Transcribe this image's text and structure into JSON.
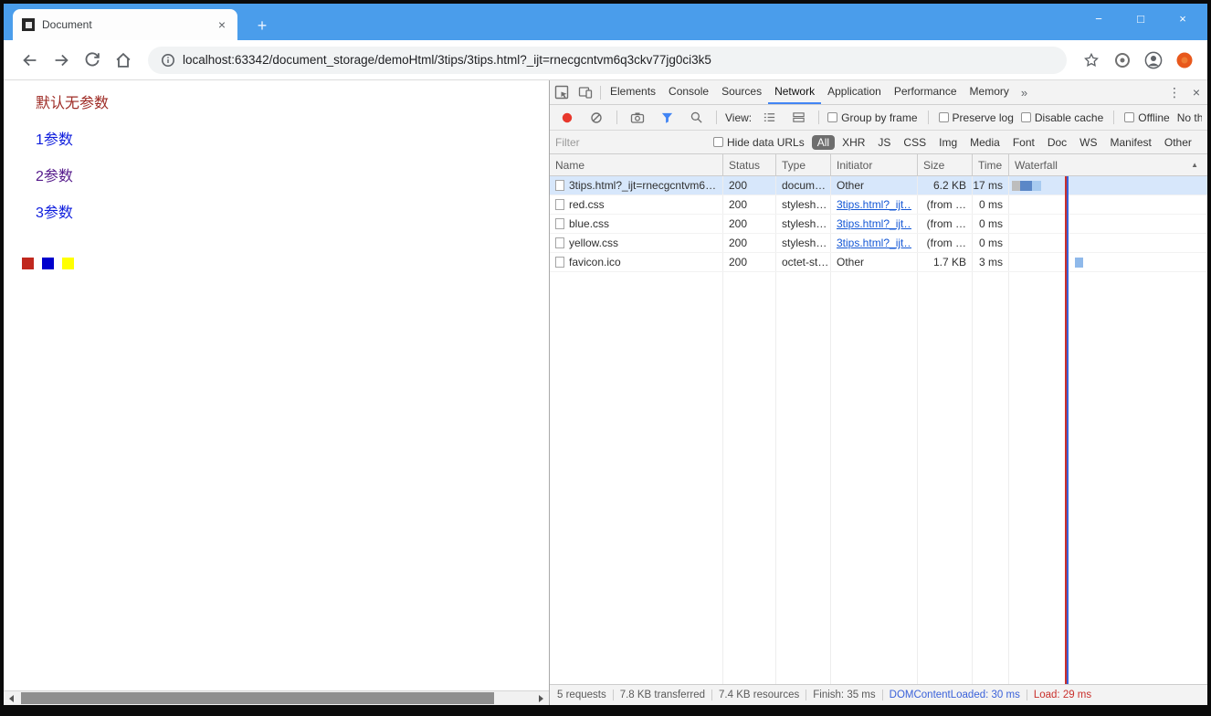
{
  "window": {
    "tab": {
      "title": "Document",
      "close_glyph": "×",
      "new_tab_glyph": "+"
    },
    "controls": {
      "minimize": "−",
      "maximize": "□",
      "close": "×"
    },
    "url": "localhost:63342/document_storage/demoHtml/3tips/3tips.html?_ijt=rnecgcntvm6q3ckv77jg0ci3k5"
  },
  "page": {
    "links": [
      {
        "label": "默认无参数",
        "color": "#9e2b25"
      },
      {
        "label": "1参数",
        "color": "#0f1edd"
      },
      {
        "label": "2参数",
        "color": "#551a8b"
      },
      {
        "label": "3参数",
        "color": "#0f1edd"
      }
    ],
    "squares": [
      {
        "name": "red-square",
        "color": "#c0281e"
      },
      {
        "name": "blue-square",
        "color": "#0000cd"
      },
      {
        "name": "yellow-square",
        "color": "#ffff00"
      }
    ]
  },
  "devtools": {
    "tabs": [
      "Elements",
      "Console",
      "Sources",
      "Network",
      "Application",
      "Performance",
      "Memory"
    ],
    "active_tab": "Network",
    "more_tabs_glyph": "»",
    "icons": {
      "more": "⋮",
      "close": "×"
    },
    "toolbar": {
      "view_label": "View:",
      "groups": [
        [
          "Group by frame"
        ],
        [
          "Preserve log",
          "Disable cache"
        ],
        [
          "Offline"
        ]
      ],
      "throttle": "No throttl"
    },
    "filter": {
      "placeholder": "Filter",
      "hide_data_urls": "Hide data URLs",
      "types": [
        "All",
        "XHR",
        "JS",
        "CSS",
        "Img",
        "Media",
        "Font",
        "Doc",
        "WS",
        "Manifest",
        "Other"
      ],
      "active_type": "All"
    },
    "table": {
      "columns": [
        "Name",
        "Status",
        "Type",
        "Initiator",
        "Size",
        "Time",
        "Waterfall"
      ],
      "sort_indicator": "▲",
      "rows": [
        {
          "name": "3tips.html?_ijt=rnecgcntvm6…",
          "status": "200",
          "type": "docum…",
          "initiator": "Other",
          "initiator_is_link": false,
          "size": "6.2 KB",
          "time": "17 ms",
          "selected": true,
          "waterfall": {
            "segments": [
              {
                "x": 3,
                "w": 9,
                "color": "#bdbdbd"
              },
              {
                "x": 12,
                "w": 13,
                "color": "#5b87c7"
              },
              {
                "x": 25,
                "w": 10,
                "color": "#a8cbf0"
              }
            ]
          }
        },
        {
          "name": "red.css",
          "status": "200",
          "type": "stylesh…",
          "initiator": "3tips.html?_ijt…",
          "initiator_is_link": true,
          "size": "(from …",
          "time": "0 ms",
          "selected": false,
          "waterfall": {
            "segments": [
              {
                "x": 61,
                "w": 3,
                "color": "#7fb0e8"
              }
            ]
          }
        },
        {
          "name": "blue.css",
          "status": "200",
          "type": "stylesh…",
          "initiator": "3tips.html?_ijt…",
          "initiator_is_link": true,
          "size": "(from …",
          "time": "0 ms",
          "selected": false,
          "waterfall": {
            "segments": [
              {
                "x": 61,
                "w": 3,
                "color": "#7fb0e8"
              }
            ]
          }
        },
        {
          "name": "yellow.css",
          "status": "200",
          "type": "stylesh…",
          "initiator": "3tips.html?_ijt…",
          "initiator_is_link": true,
          "size": "(from …",
          "time": "0 ms",
          "selected": false,
          "waterfall": {
            "segments": [
              {
                "x": 61,
                "w": 3,
                "color": "#7fb0e8"
              }
            ]
          }
        },
        {
          "name": "favicon.ico",
          "status": "200",
          "type": "octet-st…",
          "initiator": "Other",
          "initiator_is_link": false,
          "size": "1.7 KB",
          "time": "3 ms",
          "selected": false,
          "waterfall": {
            "segments": [
              {
                "x": 72,
                "w": 9,
                "color": "#8fb9ea"
              }
            ]
          }
        }
      ],
      "event_lines": [
        {
          "name": "load-event-line",
          "x": 61,
          "color": "#c9302c"
        },
        {
          "name": "dcl-event-line",
          "x": 63,
          "color": "#3b62d9"
        }
      ]
    },
    "status_bar": [
      {
        "text": "5 requests"
      },
      {
        "text": "7.8 KB transferred"
      },
      {
        "text": "7.4 KB resources"
      },
      {
        "text": "Finish: 35 ms"
      },
      {
        "text": "DOMContentLoaded: 30 ms",
        "color": "#3b62d9"
      },
      {
        "text": "Load: 29 ms",
        "color": "#c9302c"
      }
    ]
  }
}
